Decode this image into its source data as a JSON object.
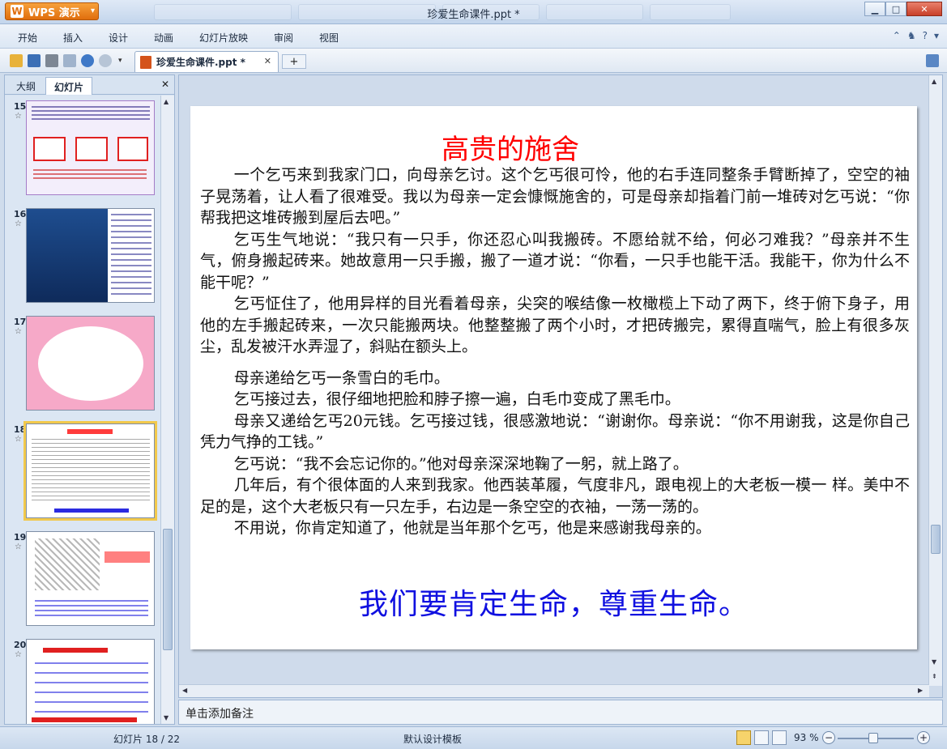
{
  "app": {
    "wps_label": "WPS 演示",
    "window_title": "珍爱生命课件.ppt *"
  },
  "menu": [
    "开始",
    "插入",
    "设计",
    "动画",
    "幻灯片放映",
    "审阅",
    "视图"
  ],
  "doc_tab": {
    "label": "珍爱生命课件.ppt *"
  },
  "left_panel": {
    "tabs": [
      "大纲",
      "幻灯片"
    ],
    "thumbnails": [
      {
        "num": "15"
      },
      {
        "num": "16"
      },
      {
        "num": "17"
      },
      {
        "num": "18"
      },
      {
        "num": "19"
      },
      {
        "num": "20"
      }
    ]
  },
  "slide": {
    "title": "高贵的施舍",
    "paragraphs": [
      "一个乞丐来到我家门口，向母亲乞讨。这个乞丐很可怜，他的右手连同整条手臂断掉了，空空的袖子晃荡着，让人看了很难受。我以为母亲一定会慷慨施舍的，可是母亲却指着门前一堆砖对乞丐说：“你帮我把这堆砖搬到屋后去吧。”",
      "乞丐生气地说：“我只有一只手，你还忍心叫我搬砖。不愿给就不给，何必刁难我？”母亲并不生气，俯身搬起砖来。她故意用一只手搬，搬了一道才说：“你看，一只手也能干活。我能干，你为什么不能干呢？”",
      "乞丐怔住了，他用异样的目光看着母亲，尖突的喉结像一枚橄榄上下动了两下，终于俯下身子，用他的左手搬起砖来，一次只能搬两块。他整整搬了两个小时，才把砖搬完，累得直喘气，脸上有很多灰尘，乱发被汗水弄湿了，斜贴在额头上。",
      "母亲递给乞丐一条雪白的毛巾。",
      "乞丐接过去，很仔细地把脸和脖子擦一遍，白毛巾变成了黑毛巾。",
      "母亲又递给乞丐20元钱。乞丐接过钱，很感激地说：“谢谢你。母亲说：“你不用谢我，这是你自己凭力气挣的工钱。”",
      "乞丐说：“我不会忘记你的。”他对母亲深深地鞠了一躬，就上路了。",
      "几年后，有个很体面的人来到我家。他西装革履，气度非凡，跟电视上的大老板一模一 样。美中不足的是，这个大老板只有一只左手，右边是一条空空的衣袖，一荡一荡的。",
      "不用说，你肯定知道了，他就是当年那个乞丐，他是来感谢我母亲的。"
    ],
    "footer": "我们要肯定生命，尊重生命。"
  },
  "notes": {
    "placeholder": "单击添加备注"
  },
  "status": {
    "slide_counter": "幻灯片 18 / 22",
    "template": "默认设计模板",
    "zoom": "93 %"
  },
  "colors": {
    "title": "#ff0000",
    "footer": "#1010e0",
    "accent": "#e06e0d"
  }
}
